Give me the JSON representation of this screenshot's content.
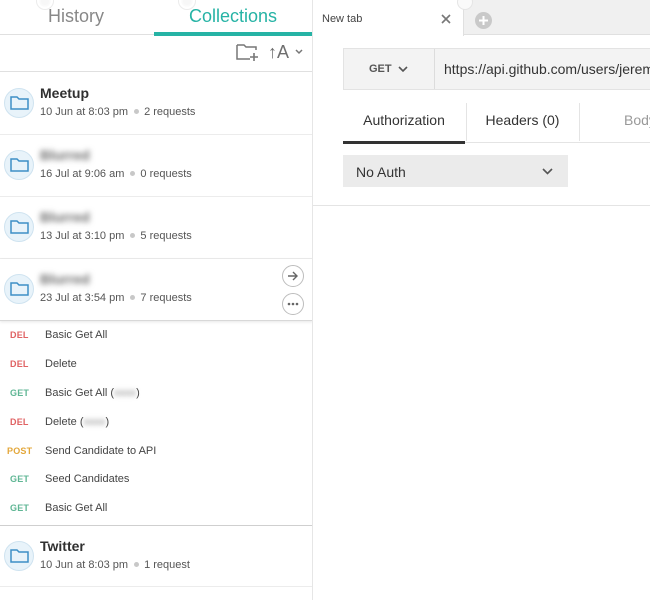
{
  "sidebar": {
    "tabs": {
      "history": "History",
      "collections": "Collections"
    },
    "toolbar": {
      "sort_label": "↑A"
    },
    "collections": [
      {
        "name": "Meetup",
        "date": "10 Jun at 8:03 pm",
        "requests": "2 requests",
        "blurred": false
      },
      {
        "name": "Blurred",
        "date": "16 Jul at 9:06 am",
        "requests": "0 requests",
        "blurred": true
      },
      {
        "name": "Blurred",
        "date": "13 Jul at 3:10 pm",
        "requests": "5 requests",
        "blurred": true
      },
      {
        "name": "Blurred",
        "date": "23 Jul at 3:54 pm",
        "requests": "7 requests",
        "blurred": true,
        "expanded": true
      }
    ],
    "requests": [
      {
        "method": "DEL",
        "name": "Basic Get All",
        "suffix": ""
      },
      {
        "method": "DEL",
        "name": "Delete",
        "suffix": ""
      },
      {
        "method": "GET",
        "name": "Basic Get All (",
        "suffix": ")"
      },
      {
        "method": "DEL",
        "name": "Delete (",
        "suffix": ")"
      },
      {
        "method": "POST",
        "name": "Send Candidate to API",
        "suffix": ""
      },
      {
        "method": "GET",
        "name": "Seed Candidates",
        "suffix": ""
      },
      {
        "method": "GET",
        "name": "Basic Get All",
        "suffix": ""
      }
    ],
    "twitter": {
      "name": "Twitter",
      "date": "10 Jun at 8:03 pm",
      "requests": "1 request"
    }
  },
  "main": {
    "tab_title": "New tab",
    "method": "GET",
    "url": "https://api.github.com/users/jerem",
    "request_tabs": {
      "authorization": "Authorization",
      "headers": "Headers (0)",
      "body": "Body"
    },
    "auth_type": "No Auth"
  },
  "colors": {
    "accent": "#26b3a5",
    "method_del": "#e06263",
    "method_get": "#5fb694",
    "method_post": "#e3a73a"
  },
  "icons": [
    "new-folder-icon",
    "sort-icon",
    "folder-icon",
    "arrow-right-icon",
    "more-icon",
    "close-icon",
    "plus-icon",
    "chevron-down-icon"
  ]
}
